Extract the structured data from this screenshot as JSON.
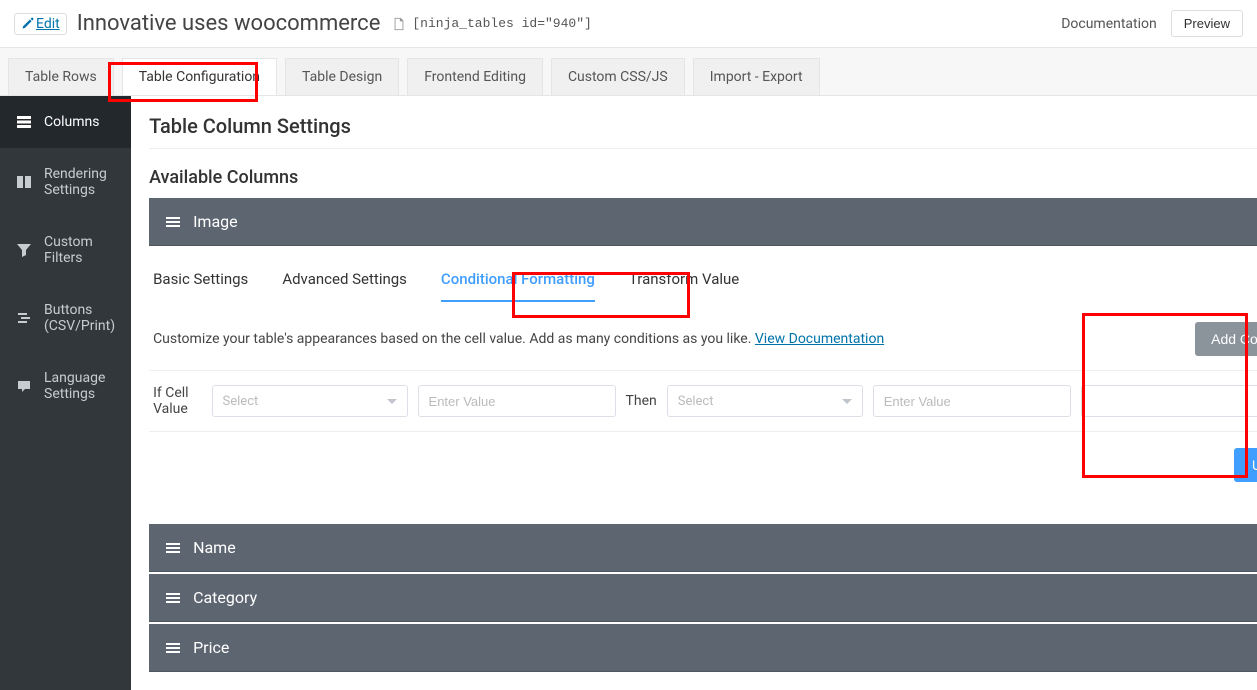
{
  "header": {
    "edit_label": "Edit",
    "page_title": "Innovative uses woocommerce",
    "shortcode": "[ninja_tables id=\"940\"]",
    "doc_link": "Documentation",
    "preview_label": "Preview"
  },
  "main_tabs": {
    "rows": "Table Rows",
    "config": "Table Configuration",
    "design": "Table Design",
    "frontend": "Frontend Editing",
    "css": "Custom CSS/JS",
    "import": "Import - Export"
  },
  "sidebar": {
    "columns": "Columns",
    "rendering": "Rendering Settings",
    "filters": "Custom Filters",
    "buttons": "Buttons (CSV/Print)",
    "language": "Language Settings"
  },
  "content": {
    "heading": "Table Column Settings",
    "available": "Available Columns"
  },
  "columns": {
    "image": "Image",
    "name": "Name",
    "category": "Category",
    "price": "Price"
  },
  "sub_tabs": {
    "basic": "Basic Settings",
    "advanced": "Advanced Settings",
    "conditional": "Conditional Formatting",
    "transform": "Transform Value"
  },
  "cond": {
    "desc": "Customize your table's appearances based on the cell value. Add as many conditions as you like. ",
    "doc_link": "View Documentation",
    "add_btn": "Add Condition",
    "if_label": "If Cell Value",
    "select_placeholder": "Select",
    "value_placeholder": "Enter Value",
    "then_label": "Then",
    "then_placeholder": "Enter Value",
    "remove_glyph": "—",
    "update_btn": "Update"
  }
}
